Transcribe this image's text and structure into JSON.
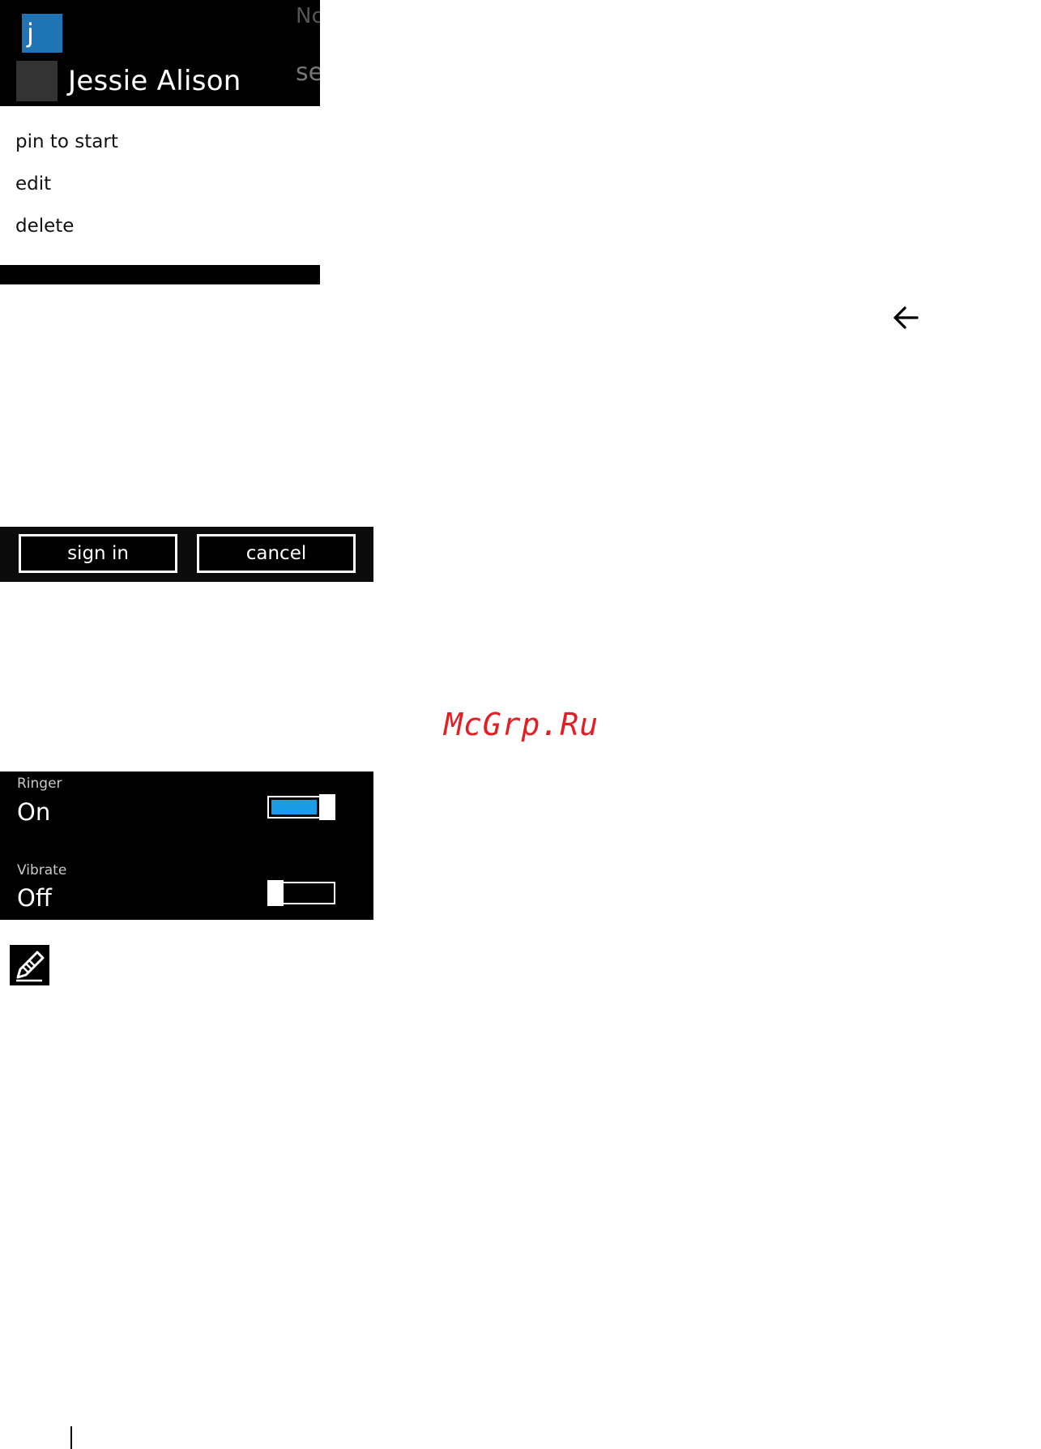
{
  "context_menu": {
    "letter_tile": "j",
    "contact_name": "Jessie Alison",
    "edge_text_top": "Nc",
    "edge_text_bottom": "se",
    "items": [
      {
        "label": "pin to start"
      },
      {
        "label": "edit"
      },
      {
        "label": "delete"
      }
    ],
    "tile_color": "#1e74b4"
  },
  "nav": {
    "back_icon": "back-arrow-icon"
  },
  "button_bar": {
    "sign_in_label": "sign in",
    "cancel_label": "cancel"
  },
  "watermark": {
    "text": "McGrp.Ru",
    "color": "#e31e24"
  },
  "settings": {
    "ringer": {
      "label": "Ringer",
      "value": "On",
      "enabled": true
    },
    "vibrate": {
      "label": "Vibrate",
      "value": "Off",
      "enabled": false
    },
    "accent_color": "#1a9be6"
  },
  "note": {
    "icon": "pencil-note-icon"
  }
}
